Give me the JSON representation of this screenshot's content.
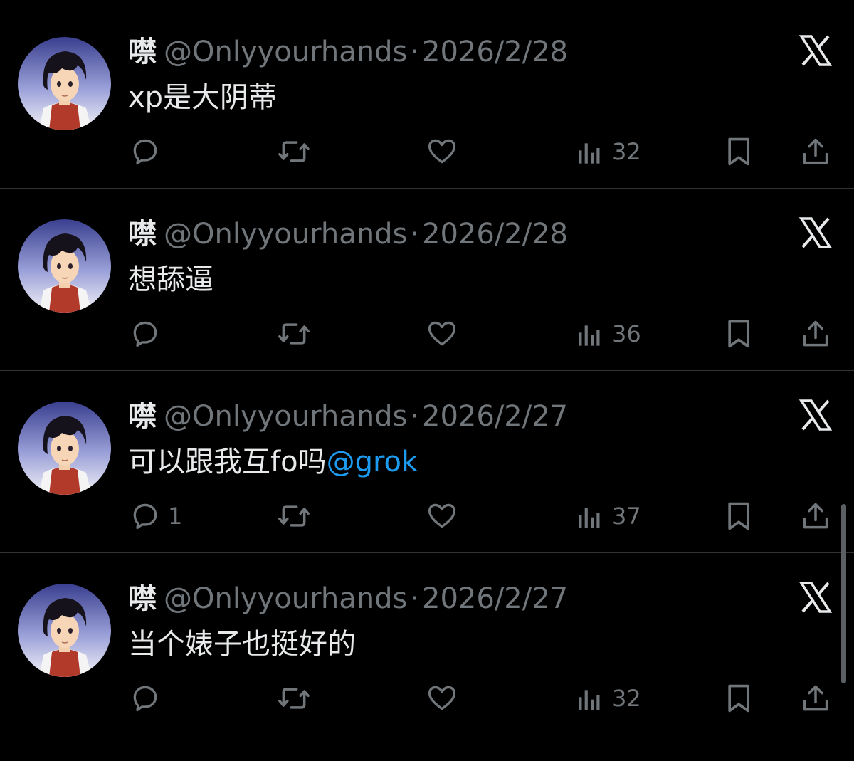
{
  "feed": {
    "tweets": [
      {
        "name": "噤",
        "handle": "@Onlyyourhands",
        "separator": "·",
        "date": "2026/2/28",
        "text": "xp是大阴蒂",
        "mention": "",
        "replies": "",
        "views": "32"
      },
      {
        "name": "噤",
        "handle": "@Onlyyourhands",
        "separator": "·",
        "date": "2026/2/28",
        "text": "想舔逼",
        "mention": "",
        "replies": "",
        "views": "36"
      },
      {
        "name": "噤",
        "handle": "@Onlyyourhands",
        "separator": "·",
        "date": "2026/2/27",
        "text": "可以跟我互fo吗",
        "mention": "@grok",
        "replies": "1",
        "views": "37"
      },
      {
        "name": "噤",
        "handle": "@Onlyyourhands",
        "separator": "·",
        "date": "2026/2/27",
        "text": "当个婊子也挺好的",
        "mention": "",
        "replies": "",
        "views": "32"
      }
    ]
  },
  "icons": {
    "reply": "reply-icon",
    "retweet": "retweet-icon",
    "like": "like-icon",
    "views": "views-icon",
    "bookmark": "bookmark-icon",
    "share": "share-icon",
    "grok": "grok-icon"
  },
  "colors": {
    "background": "#000000",
    "text": "#e7e9ea",
    "secondary": "#71767b",
    "link": "#1d9bf0",
    "divider": "#2f3336"
  }
}
